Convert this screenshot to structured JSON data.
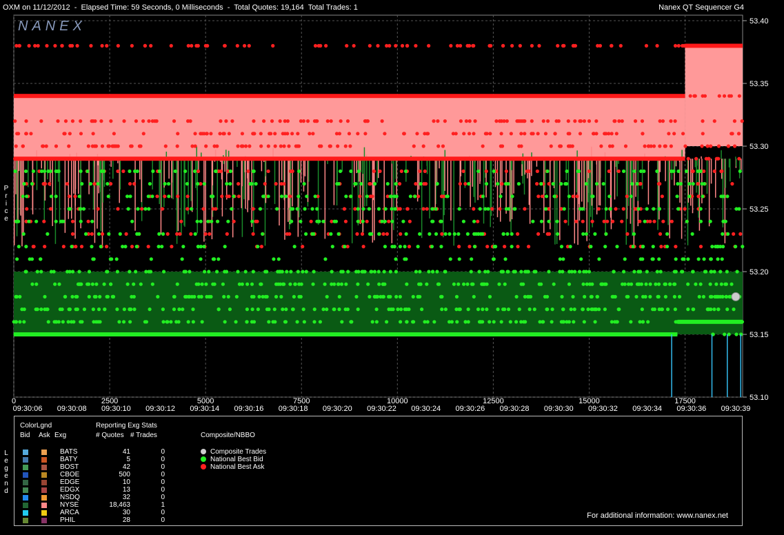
{
  "header": {
    "left": "OXM on 11/12/2012  -  Elapsed Time: 59 Seconds, 0 Milliseconds  -  Total Quotes: 19,164  Total Trades: 1",
    "right": "Nanex QT Sequencer G4"
  },
  "watermark": "NANEX",
  "axis_label_y": [
    "P",
    "r",
    "i",
    "c",
    "e"
  ],
  "legend_label": [
    "L",
    "e",
    "g",
    "e",
    "n",
    "d"
  ],
  "chart_data": {
    "type": "scatter",
    "title": "",
    "ylim": [
      53.1,
      53.4
    ],
    "yticks": [
      "53.10",
      "53.15",
      "53.20",
      "53.25",
      "53.30",
      "53.35",
      "53.40"
    ],
    "xlim": [
      0,
      19000
    ],
    "xticks": [
      "0",
      "2500",
      "5000",
      "7500",
      "10000",
      "12500",
      "15000",
      "17500"
    ],
    "time_labels": [
      "09:30:06",
      "09:30:08",
      "09:30:10",
      "09:30:12",
      "09:30:14",
      "09:30:16",
      "09:30:18",
      "09:30:20",
      "09:30:22",
      "09:30:24",
      "09:30:26",
      "09:30:28",
      "09:30:30",
      "09:30:32",
      "09:30:34",
      "09:30:36",
      "09:30:39"
    ],
    "series": [
      {
        "name": "National Best Ask",
        "color": "#ff2020",
        "levels": [
          53.38,
          53.34,
          53.32,
          53.31,
          53.3,
          53.29,
          53.28,
          53.27,
          53.26,
          53.25,
          53.24,
          53.23,
          53.22
        ]
      },
      {
        "name": "National Best Bid",
        "color": "#22ee22",
        "levels": [
          53.15,
          53.16,
          53.17,
          53.18,
          53.19,
          53.2,
          53.21,
          53.22,
          53.23,
          53.24,
          53.25,
          53.26,
          53.27,
          53.28
        ]
      },
      {
        "name": "Composite Trades",
        "color": "#cccccc",
        "points": [
          {
            "x": 19000,
            "y": 53.18
          }
        ]
      }
    ],
    "persistent_ask": [
      {
        "x0": 0,
        "x1": 17500,
        "y": 53.34
      },
      {
        "x0": 0,
        "x1": 17500,
        "y": 53.29
      },
      {
        "x0": 17500,
        "x1": 19000,
        "y": 53.38
      }
    ],
    "persistent_bid": [
      {
        "x0": 0,
        "x1": 17300,
        "y": 53.15
      },
      {
        "x0": 17300,
        "x1": 19000,
        "y": 53.16
      }
    ],
    "trade_lines": [
      17150,
      18200,
      18600,
      18950
    ]
  },
  "legend": {
    "colorlgnd": "ColorLgnd",
    "col_bid": "Bid",
    "col_ask": "Ask",
    "col_exg": "Exg",
    "stats_title": "Reporting Exg Stats",
    "col_quotes": "# Quotes",
    "col_trades": "# Trades",
    "composite_title": "Composite/NBBO",
    "rows": [
      {
        "exg": "BATS",
        "quotes": "41",
        "trades": "0",
        "bid": "#55aadd",
        "ask": "#eea050"
      },
      {
        "exg": "BATY",
        "quotes": "5",
        "trades": "0",
        "bid": "#4477aa",
        "ask": "#cc5522"
      },
      {
        "exg": "BOST",
        "quotes": "42",
        "trades": "0",
        "bid": "#449955",
        "ask": "#aa5544"
      },
      {
        "exg": "CBOE",
        "quotes": "500",
        "trades": "0",
        "bid": "#2255bb",
        "ask": "#bb8822"
      },
      {
        "exg": "EDGE",
        "quotes": "10",
        "trades": "0",
        "bid": "#336644",
        "ask": "#994433"
      },
      {
        "exg": "EDGX",
        "quotes": "13",
        "trades": "0",
        "bid": "#448855",
        "ask": "#aa4444"
      },
      {
        "exg": "NSDQ",
        "quotes": "32",
        "trades": "0",
        "bid": "#2288ee",
        "ask": "#ee9933"
      },
      {
        "exg": "NYSE",
        "quotes": "18,463",
        "trades": "1",
        "bid": "#226633",
        "ask": "#ff8888"
      },
      {
        "exg": "ARCA",
        "quotes": "30",
        "trades": "0",
        "bid": "#22ccee",
        "ask": "#eecc11"
      },
      {
        "exg": "PHIL",
        "quotes": "28",
        "trades": "0",
        "bid": "#668833",
        "ask": "#883366"
      }
    ],
    "composite": [
      {
        "label": "Composite Trades",
        "color": "#cccccc"
      },
      {
        "label": "National Best Bid",
        "color": "#22ee22"
      },
      {
        "label": "National Best Ask",
        "color": "#ff2020"
      }
    ],
    "info": "For additional information: www.nanex.net"
  }
}
